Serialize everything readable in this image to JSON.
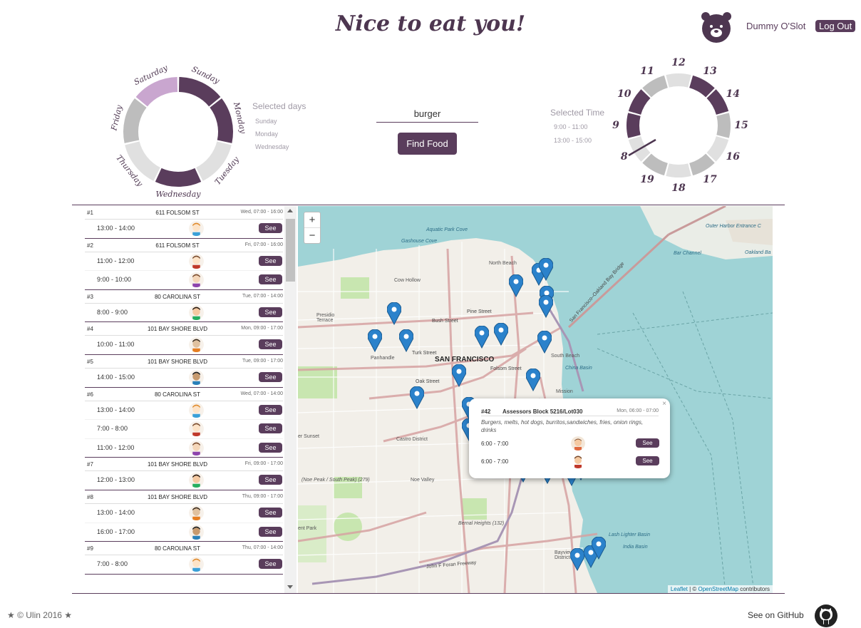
{
  "header": {
    "title": "Nice to eat you!",
    "username": "Dummy O'Slot",
    "logout_label": "Log Out"
  },
  "days_wheel": {
    "days": [
      "Sunday",
      "Monday",
      "Tuesday",
      "Wednesday",
      "Thursday",
      "Friday",
      "Saturday"
    ],
    "selected": [
      "Sunday",
      "Monday",
      "Wednesday"
    ],
    "hovered": "Saturday"
  },
  "selected_days": {
    "label": "Selected days",
    "items": [
      "Sunday",
      "Monday",
      "Wednesday"
    ]
  },
  "search": {
    "value": "burger",
    "button_label": "Find Food"
  },
  "selected_time": {
    "label": "Selected Time",
    "items": [
      "9:00 - 11:00",
      "13:00 - 15:00"
    ]
  },
  "clock": {
    "hours": [
      "12",
      "13",
      "14",
      "15",
      "16",
      "17",
      "18",
      "19",
      "8",
      "9",
      "10",
      "11"
    ],
    "selected_hours": [
      "9",
      "10",
      "13",
      "14"
    ]
  },
  "trucks": [
    {
      "num": "#1",
      "address": "611 FOLSOM ST",
      "hours": "Wed, 07:00 - 16:00",
      "slots": [
        {
          "time": "13:00 - 14:00",
          "see": "See"
        }
      ]
    },
    {
      "num": "#2",
      "address": "611 FOLSOM ST",
      "hours": "Fri, 07:00 - 16:00",
      "slots": [
        {
          "time": "11:00 - 12:00",
          "see": "See"
        },
        {
          "time": "9:00 - 10:00",
          "see": "See"
        }
      ]
    },
    {
      "num": "#3",
      "address": "80 CAROLINA ST",
      "hours": "Tue, 07:00 - 14:00",
      "slots": [
        {
          "time": "8:00 - 9:00",
          "see": "See"
        }
      ]
    },
    {
      "num": "#4",
      "address": "101 BAY SHORE BLVD",
      "hours": "Mon, 09:00 - 17:00",
      "slots": [
        {
          "time": "10:00 - 11:00",
          "see": "See"
        }
      ]
    },
    {
      "num": "#5",
      "address": "101 BAY SHORE BLVD",
      "hours": "Tue, 09:00 - 17:00",
      "slots": [
        {
          "time": "14:00 - 15:00",
          "see": "See"
        }
      ]
    },
    {
      "num": "#6",
      "address": "80 CAROLINA ST",
      "hours": "Wed, 07:00 - 14:00",
      "slots": [
        {
          "time": "13:00 - 14:00",
          "see": "See"
        },
        {
          "time": "7:00 - 8:00",
          "see": "See"
        },
        {
          "time": "11:00 - 12:00",
          "see": "See"
        }
      ]
    },
    {
      "num": "#7",
      "address": "101 BAY SHORE BLVD",
      "hours": "Fri, 09:00 - 17:00",
      "slots": [
        {
          "time": "12:00 - 13:00",
          "see": "See"
        }
      ]
    },
    {
      "num": "#8",
      "address": "101 BAY SHORE BLVD",
      "hours": "Thu, 09:00 - 17:00",
      "slots": [
        {
          "time": "13:00 - 14:00",
          "see": "See"
        },
        {
          "time": "16:00 - 17:00",
          "see": "See"
        }
      ]
    },
    {
      "num": "#9",
      "address": "80 CAROLINA ST",
      "hours": "Thu, 07:00 - 14:00",
      "slots": [
        {
          "time": "7:00 - 8:00",
          "see": "See"
        }
      ]
    }
  ],
  "map": {
    "zoom_in": "+",
    "zoom_out": "−",
    "labels": {
      "aquatic_park": "Aquatic Park Cove",
      "gashouse": "Gashouse Cove",
      "north_beach": "North Beach",
      "cow_hollow": "Cow Hollow",
      "presidio": "Presidio Terrace",
      "bush": "Bush Street",
      "pine": "Pine Street",
      "sf": "SAN FRANCISCO",
      "south_beach": "South Beach",
      "china_basin": "China Basin",
      "mission": "Mission",
      "castro": "Castro District",
      "noe": "Noe Valley",
      "outer_harbor": "Outer Harbor Entrance C",
      "bar_channel": "Bar Channel",
      "oakland_bay": "Oakland Ba",
      "bay_bridge": "San Francisco–Oakland Bay Bridge",
      "lash": "Lash Lighter Basin",
      "india": "India Basin",
      "bayview": "Bayview District",
      "bernal": "Bernal Heights (132)",
      "foran": "John F Foran Freeway",
      "sunset": "er Sunset",
      "noe_peak": "(Noe Peak / South Peak) (279)",
      "park": "ent Park",
      "turk": "Turk Street",
      "oak": "Oak Street",
      "folsom": "Folsom Street",
      "panhandle": "Panhandle"
    },
    "attribution_leaflet": "Leaflet",
    "attribution_sep": " | © ",
    "attribution_osm": "OpenStreetMap",
    "attribution_tail": " contributors"
  },
  "popup": {
    "close": "×",
    "num": "#42",
    "name": "Assessors Block 5216/Lot030",
    "hours": "Mon, 06:00 - 07:00",
    "description": "Burgers, melts, hot dogs, burritos,sandwiches, fries, onion rings, drinks",
    "slots": [
      {
        "time": "6:00 - 7:00",
        "see": "See"
      },
      {
        "time": "6:00 - 7:00",
        "see": "See"
      }
    ]
  },
  "footer": {
    "copyright": "★ © Ulin 2016 ★",
    "github": "See on GitHub"
  },
  "colors": {
    "brand": "#5a3d5c",
    "selected_segment": "#5a3d5c",
    "hover_segment": "#c9a6cf",
    "idle_segment_light": "#e0e0e0",
    "idle_segment_dark": "#bdbdbd",
    "marker": "#2b82cb",
    "water": "#9fd3d6"
  }
}
